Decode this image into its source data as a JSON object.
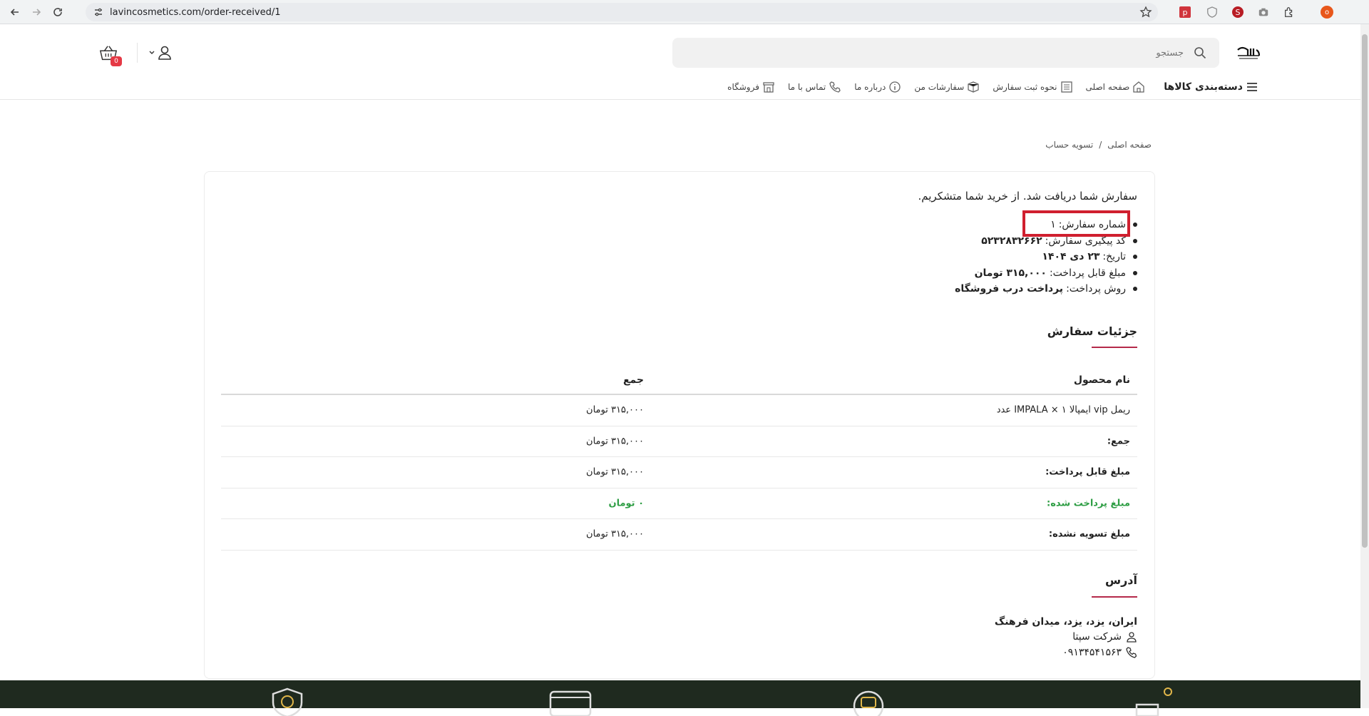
{
  "browser": {
    "url": "lavincosmetics.com/order-received/1",
    "profile_initial": "o"
  },
  "header": {
    "search_placeholder": "جستجو",
    "cart_count": "0",
    "menu": {
      "categories": "دسته‌بندی کالاها",
      "home": "صفحه اصلی",
      "how_to_order": "نحوه ثبت سفارش",
      "my_orders": "سفارشات من",
      "about": "درباره ما",
      "contact": "تماس با ما",
      "shop": "فروشگاه"
    }
  },
  "breadcrumb": {
    "home": "صفحه اصلی",
    "separator": "/",
    "current": "تسویه حساب"
  },
  "order": {
    "message": "سفارش شما دریافت شد. از خرید شما متشکریم.",
    "info": [
      {
        "label": "شماره سفارش:",
        "value": "۱"
      },
      {
        "label": "کد پیگیری سفارش:",
        "value": "۵۲۳۲۸۳۲۶۶۲"
      },
      {
        "label": "تاریخ:",
        "value": "۲۳ دی ۱۴۰۴"
      },
      {
        "label": "مبلغ قابل پرداخت:",
        "value": "۳۱۵,۰۰۰ تومان"
      },
      {
        "label": "روش پرداخت:",
        "value": "پرداخت درب فروشگاه"
      }
    ]
  },
  "details": {
    "title": "جزئیات سفارش",
    "col_product": "نام محصول",
    "col_total": "جمع",
    "rows": [
      {
        "label": "ریمل vip ایمپالا IMPALA × ۱ عدد",
        "value": "۳۱۵,۰۰۰ تومان"
      },
      {
        "label": "جمع:",
        "value": "۳۱۵,۰۰۰ تومان"
      },
      {
        "label": "مبلغ قابل پرداخت:",
        "value": "۳۱۵,۰۰۰ تومان"
      },
      {
        "label": "مبلغ پرداخت شده:",
        "value": "۰ تومان"
      },
      {
        "label": "مبلغ تسویه نشده:",
        "value": "۳۱۵,۰۰۰ تومان"
      }
    ]
  },
  "address": {
    "title": "آدرس",
    "location": "ایران، یزد، یزد، میدان فرهنگ",
    "company": "شرکت سپتا",
    "phone": "۰۹۱۳۴۵۴۱۵۶۳"
  },
  "colors": {
    "accent": "#b5294a",
    "highlight": "#d01f2f",
    "paid_green": "#2f9e45",
    "footer_bg": "#1f2a1f"
  }
}
